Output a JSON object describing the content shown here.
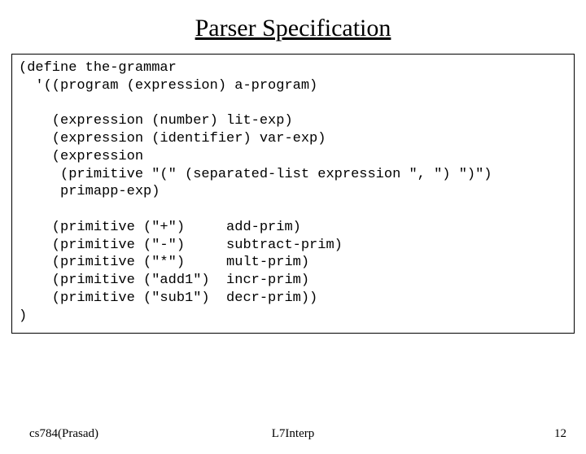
{
  "title": "Parser Specification",
  "code": "(define the-grammar\n  '((program (expression) a-program)\n\n    (expression (number) lit-exp)\n    (expression (identifier) var-exp)\n    (expression\n     (primitive \"(\" (separated-list expression \", \") \")\")\n     primapp-exp)\n\n    (primitive (\"+\")     add-prim)\n    (primitive (\"-\")     subtract-prim)\n    (primitive (\"*\")     mult-prim)\n    (primitive (\"add1\")  incr-prim)\n    (primitive (\"sub1\")  decr-prim))\n)",
  "footer": {
    "left": "cs784(Prasad)",
    "center": "L7Interp",
    "right": "12"
  }
}
